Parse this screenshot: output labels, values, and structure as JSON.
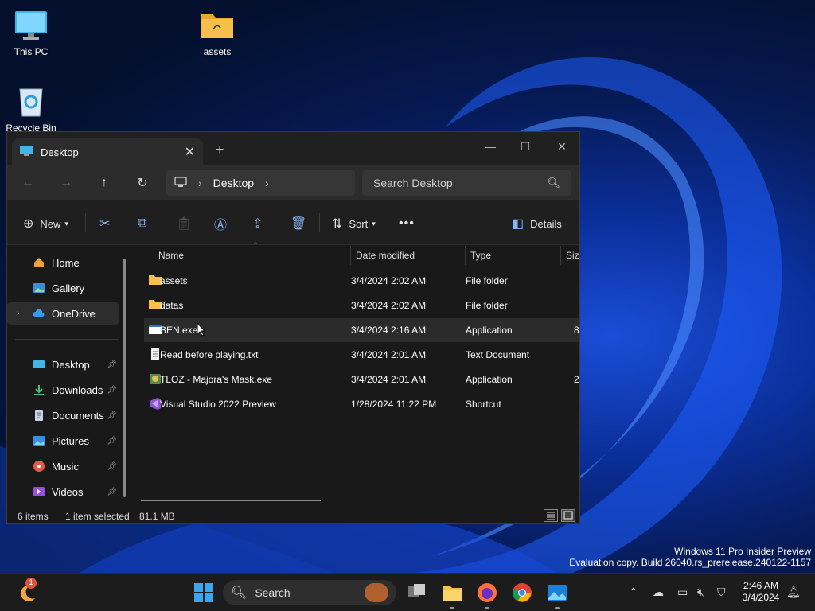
{
  "desktop": {
    "icons": [
      {
        "label": "This PC"
      },
      {
        "label": "assets"
      },
      {
        "label": "Recycle Bin"
      }
    ]
  },
  "window": {
    "tab_title": "Desktop",
    "nav": {
      "address": [
        "Desktop"
      ],
      "search_placeholder": "Search Desktop"
    },
    "toolbar": {
      "new_label": "New",
      "sort_label": "Sort",
      "details_label": "Details"
    },
    "sidebar": {
      "top": [
        {
          "label": "Home"
        },
        {
          "label": "Gallery"
        },
        {
          "label": "OneDrive"
        }
      ],
      "quick": [
        {
          "label": "Desktop"
        },
        {
          "label": "Downloads"
        },
        {
          "label": "Documents"
        },
        {
          "label": "Pictures"
        },
        {
          "label": "Music"
        },
        {
          "label": "Videos"
        }
      ]
    },
    "columns": [
      "Name",
      "Date modified",
      "Type",
      "Size"
    ],
    "files": [
      {
        "name": "assets",
        "date": "3/4/2024 2:02 AM",
        "type": "File folder",
        "size": ""
      },
      {
        "name": "datas",
        "date": "3/4/2024 2:02 AM",
        "type": "File folder",
        "size": ""
      },
      {
        "name": "BEN.exe",
        "date": "3/4/2024 2:16 AM",
        "type": "Application",
        "size": "8"
      },
      {
        "name": "Read before playing.txt",
        "date": "3/4/2024 2:01 AM",
        "type": "Text Document",
        "size": ""
      },
      {
        "name": "TLOZ - Majora's Mask.exe",
        "date": "3/4/2024 2:01 AM",
        "type": "Application",
        "size": "2"
      },
      {
        "name": "Visual Studio 2022 Preview",
        "date": "1/28/2024 11:22 PM",
        "type": "Shortcut",
        "size": ""
      }
    ],
    "status": {
      "count": "6 items",
      "selected": "1 item selected",
      "size": "81.1 MB"
    }
  },
  "watermark": {
    "line1": "Windows 11 Pro Insider Preview",
    "line2": "Evaluation copy. Build 26040.rs_prerelease.240122-1157"
  },
  "taskbar": {
    "search_label": "Search",
    "badge": "1",
    "time": "2:46 AM",
    "date": "3/4/2024"
  },
  "colors": {
    "accent": "#0078d4",
    "folder": "#f5c04a",
    "window_bg": "#191919"
  }
}
